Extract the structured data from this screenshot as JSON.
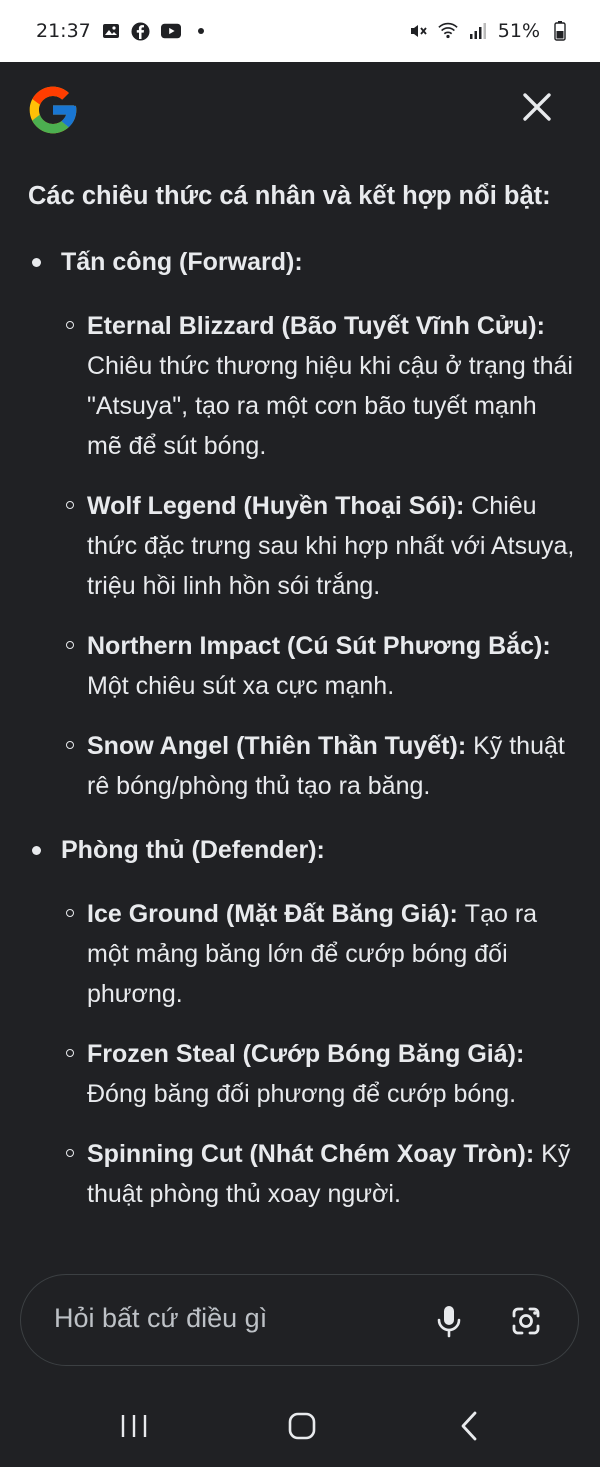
{
  "status_bar": {
    "time": "21:37",
    "battery": "51%"
  },
  "content": {
    "heading": "Các chiêu thức cá nhân và kết hợp nổi bật:",
    "sections": [
      {
        "title": "Tấn công (Forward):",
        "items": [
          {
            "name": "Eternal Blizzard (Bão Tuyết Vĩnh Cửu):",
            "desc": "Chiêu thức thương hiệu khi cậu ở trạng thái \"Atsuya\", tạo ra một cơn bão tuyết mạnh mẽ để sút bóng."
          },
          {
            "name": "Wolf Legend (Huyền Thoại Sói):",
            "desc": "Chiêu thức đặc trưng sau khi hợp nhất với Atsuya, triệu hồi linh hồn sói trắng."
          },
          {
            "name": "Northern Impact (Cú Sút Phương Bắc):",
            "desc": "Một chiêu sút xa cực mạnh."
          },
          {
            "name": "Snow Angel (Thiên Thần Tuyết):",
            "desc": "Kỹ thuật rê bóng/phòng thủ tạo ra băng."
          }
        ]
      },
      {
        "title": "Phòng thủ (Defender):",
        "items": [
          {
            "name": "Ice Ground (Mặt Đất Băng Giá):",
            "desc": "Tạo ra một mảng băng lớn để cướp bóng đối phương."
          },
          {
            "name": "Frozen Steal (Cướp Bóng Băng Giá):",
            "desc": "Đóng băng đối phương để cướp bóng."
          },
          {
            "name": "Spinning Cut (Nhát Chém Xoay Tròn):",
            "desc": "Kỹ thuật phòng thủ xoay người."
          }
        ]
      }
    ]
  },
  "search": {
    "placeholder": "Hỏi bất cứ điều gì"
  },
  "icons": {
    "google": "google-g-logo",
    "close": "close-icon",
    "mic": "mic-icon",
    "lens": "lens-camera-icon",
    "nav_recents": "recents-icon",
    "nav_home": "home-icon",
    "nav_back": "back-icon"
  },
  "colors": {
    "background": "#202124",
    "text": "#e8eaed",
    "status_bar": "#ffffff"
  }
}
